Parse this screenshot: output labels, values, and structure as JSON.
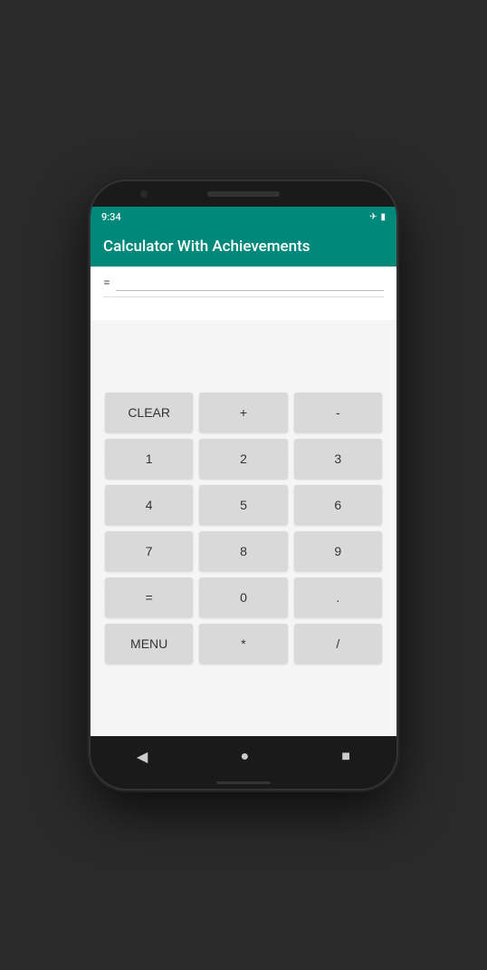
{
  "status": {
    "time": "9:34",
    "airplane_icon": "✈",
    "battery_icon": "▮"
  },
  "header": {
    "title": "Calculator With Achievements"
  },
  "display": {
    "equals_sign": "=",
    "input_value": "",
    "result_value": ""
  },
  "buttons": {
    "row1": [
      {
        "label": "CLEAR",
        "id": "clear"
      },
      {
        "label": "+",
        "id": "plus"
      },
      {
        "label": "-",
        "id": "minus"
      }
    ],
    "row2": [
      {
        "label": "1",
        "id": "one"
      },
      {
        "label": "2",
        "id": "two"
      },
      {
        "label": "3",
        "id": "three"
      }
    ],
    "row3": [
      {
        "label": "4",
        "id": "four"
      },
      {
        "label": "5",
        "id": "five"
      },
      {
        "label": "6",
        "id": "six"
      }
    ],
    "row4": [
      {
        "label": "7",
        "id": "seven"
      },
      {
        "label": "8",
        "id": "eight"
      },
      {
        "label": "9",
        "id": "nine"
      }
    ],
    "row5": [
      {
        "label": "=",
        "id": "equals"
      },
      {
        "label": "0",
        "id": "zero"
      },
      {
        "label": ".",
        "id": "dot"
      }
    ],
    "row6": [
      {
        "label": "MENU",
        "id": "menu"
      },
      {
        "label": "*",
        "id": "multiply"
      },
      {
        "label": "/",
        "id": "divide"
      }
    ]
  },
  "nav": {
    "back_label": "◀",
    "home_label": "●",
    "recent_label": "■"
  }
}
